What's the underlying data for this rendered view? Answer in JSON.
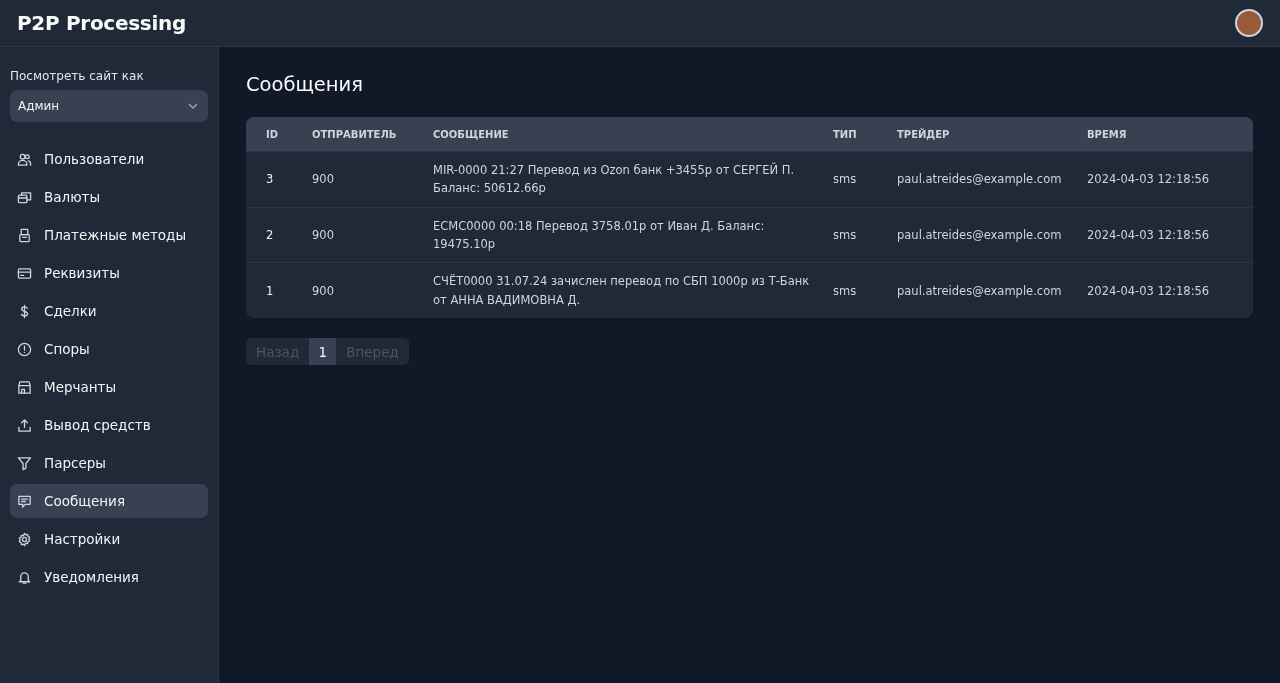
{
  "header": {
    "brand": "P2P Processing"
  },
  "sidebar": {
    "view_as": {
      "label": "Посмотреть сайт как",
      "value": "Админ"
    },
    "items": [
      {
        "label": "Пользователи",
        "selected": false
      },
      {
        "label": "Валюты",
        "selected": false
      },
      {
        "label": "Платежные методы",
        "selected": false
      },
      {
        "label": "Реквизиты",
        "selected": false
      },
      {
        "label": "Сделки",
        "selected": false
      },
      {
        "label": "Споры",
        "selected": false
      },
      {
        "label": "Мерчанты",
        "selected": false
      },
      {
        "label": "Вывод средств",
        "selected": false
      },
      {
        "label": "Парсеры",
        "selected": false
      },
      {
        "label": "Сообщения",
        "selected": true
      },
      {
        "label": "Настройки",
        "selected": false
      },
      {
        "label": "Уведомления",
        "selected": false
      }
    ]
  },
  "page": {
    "title": "Сообщения"
  },
  "table": {
    "columns": [
      "ID",
      "ОТПРАВИТЕЛЬ",
      "СООБЩЕНИЕ",
      "ТИП",
      "ТРЕЙДЕР",
      "ВРЕМЯ"
    ],
    "rows": [
      [
        "3",
        "900",
        "MIR-0000 21:27 Перевод из Ozon банк +3455р от СЕРГЕЙ П. Баланс: 50612.66р",
        "sms",
        "paul.atreides@example.com",
        "2024-04-03 12:18:56"
      ],
      [
        "2",
        "900",
        "ECMC0000 00:18 Перевод 3758.01р от Иван Д. Баланс: 19475.10р",
        "sms",
        "paul.atreides@example.com",
        "2024-04-03 12:18:56"
      ],
      [
        "1",
        "900",
        "СЧЁТ0000 31.07.24 зачислен перевод по СБП 1000р из Т-Банк от АННА ВАДИМОВНА Д.",
        "sms",
        "paul.atreides@example.com",
        "2024-04-03 12:18:56"
      ]
    ]
  },
  "pagination": [
    {
      "label": "Назад",
      "kind": "prev",
      "selected": false,
      "disabled": true
    },
    {
      "label": "1",
      "kind": "page",
      "selected": true,
      "disabled": false
    },
    {
      "label": "Вперед",
      "kind": "next",
      "selected": false,
      "disabled": true
    }
  ]
}
